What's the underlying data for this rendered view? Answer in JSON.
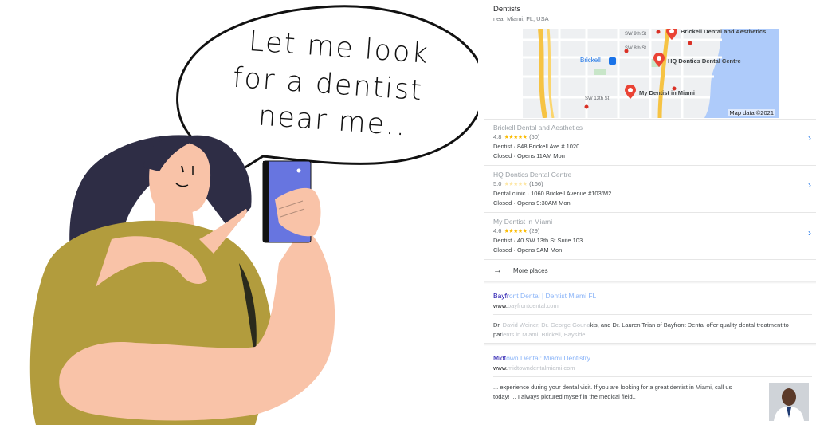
{
  "bubble": {
    "line1": "Let me look",
    "line2": "for a dentist",
    "line3": "near me.."
  },
  "colors": {
    "shirt": "#b29c3d",
    "skin": "#f9c3a8",
    "hair": "#2e2d45",
    "phone": "#6775e0",
    "link_blue": "#1a0dab",
    "star": "#fbbc04"
  },
  "local_pack": {
    "title": "Dentists",
    "subtitle": "near Miami, FL, USA",
    "map": {
      "labels": [
        "SW 9th St",
        "SW 8th St",
        "SW 13th St",
        "Brickell",
        "Brickell Dental and Aesthetics",
        "HQ Dontics Dental Centre",
        "My Dentist in Miami"
      ],
      "copyright": "Map data ©2021"
    },
    "places": [
      {
        "name": "Brickell Dental and Aesthetics",
        "rating": "4.8",
        "stars": "★★★★★",
        "reviews": "(50)",
        "details": "Dentist · 848 Brickell Ave # 1020",
        "hours": "Closed · Opens 11AM Mon"
      },
      {
        "name": "HQ Dontics Dental Centre",
        "rating": "5.0",
        "stars": "★★★★★",
        "reviews": "(166)",
        "details": "Dental clinic · 1060 Brickell Avenue #103/M2",
        "hours": "Closed · Opens 9:30AM Mon"
      },
      {
        "name": "My Dentist in Miami",
        "rating": "4.6",
        "stars": "★★★★★",
        "reviews": "(29)",
        "details": "Dentist · 40 SW 13th St Suite 103",
        "hours": "Closed · Opens 9AM Mon"
      }
    ],
    "more_label": "More places"
  },
  "results": [
    {
      "title_a": "Bayfr",
      "title_b": "ont Dental | Dentist Miami FL",
      "url_a": "www.",
      "url_b": "bayfrontdental.com",
      "snippet_a": "Dr. ",
      "snippet_b": "David Weiner, Dr. George Gouna",
      "snippet_c": "kis, and Dr. Lauren Trian of Bayfront Dental offer quality dental treatment to",
      "snippet_d": "pat",
      "snippet_e": "ients in Miami, Brickell, Bayside, ..."
    },
    {
      "title_a": "Midt",
      "title_b": "own Dental: Miami Dentistry",
      "url_a": "www.",
      "url_b": "midtowndentalmiami.com",
      "snippet_1": "... experience during your dental visit. If you are looking for a great dentist in Miami, call us",
      "snippet_2": "today! ... I always pictured myself in the medical field,."
    }
  ]
}
